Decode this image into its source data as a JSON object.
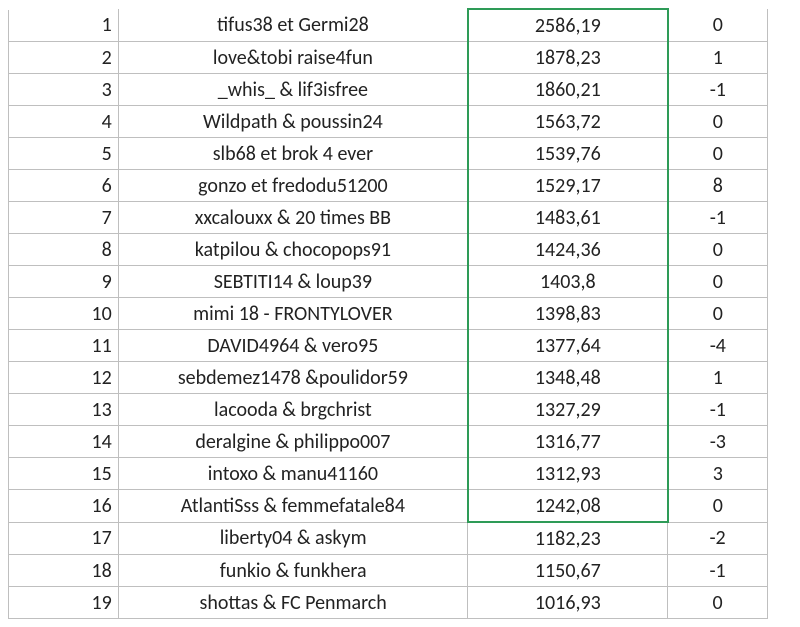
{
  "rows": [
    {
      "rank": "1",
      "name": "tifus38 et Germi28",
      "score": "2586,19",
      "delta": "0"
    },
    {
      "rank": "2",
      "name": "love&tobi raise4fun",
      "score": "1878,23",
      "delta": "1"
    },
    {
      "rank": "3",
      "name": "_whis_ & lif3isfree",
      "score": "1860,21",
      "delta": "-1"
    },
    {
      "rank": "4",
      "name": "Wildpath & poussin24",
      "score": "1563,72",
      "delta": "0"
    },
    {
      "rank": "5",
      "name": "slb68 et brok 4 ever",
      "score": "1539,76",
      "delta": "0"
    },
    {
      "rank": "6",
      "name": "gonzo et fredodu51200",
      "score": "1529,17",
      "delta": "8"
    },
    {
      "rank": "7",
      "name": "xxcalouxx & 20 times BB",
      "score": "1483,61",
      "delta": "-1"
    },
    {
      "rank": "8",
      "name": "katpilou & chocopops91",
      "score": "1424,36",
      "delta": "0"
    },
    {
      "rank": "9",
      "name": "SEBTITI14 & loup39",
      "score": "1403,8",
      "delta": "0"
    },
    {
      "rank": "10",
      "name": "mimi 18 - FRONTYLOVER",
      "score": "1398,83",
      "delta": "0"
    },
    {
      "rank": "11",
      "name": "DAVID4964 & vero95",
      "score": "1377,64",
      "delta": "-4"
    },
    {
      "rank": "12",
      "name": "sebdemez1478 &poulidor59",
      "score": "1348,48",
      "delta": "1"
    },
    {
      "rank": "13",
      "name": "lacooda & brgchrist",
      "score": "1327,29",
      "delta": "-1"
    },
    {
      "rank": "14",
      "name": "deralgine & philippo007",
      "score": "1316,77",
      "delta": "-3"
    },
    {
      "rank": "15",
      "name": "intoxo & manu41160",
      "score": "1312,93",
      "delta": "3"
    },
    {
      "rank": "16",
      "name": "AtlantiSss & femmefatale84",
      "score": "1242,08",
      "delta": "0"
    },
    {
      "rank": "17",
      "name": "liberty04 & askym",
      "score": "1182,23",
      "delta": "-2"
    },
    {
      "rank": "18",
      "name": "funkio & funkhera",
      "score": "1150,67",
      "delta": "-1"
    },
    {
      "rank": "19",
      "name": "shottas & FC Penmarch",
      "score": "1016,93",
      "delta": "0"
    }
  ],
  "selection": {
    "column": "score",
    "from_row": 0,
    "to_row": 15
  }
}
